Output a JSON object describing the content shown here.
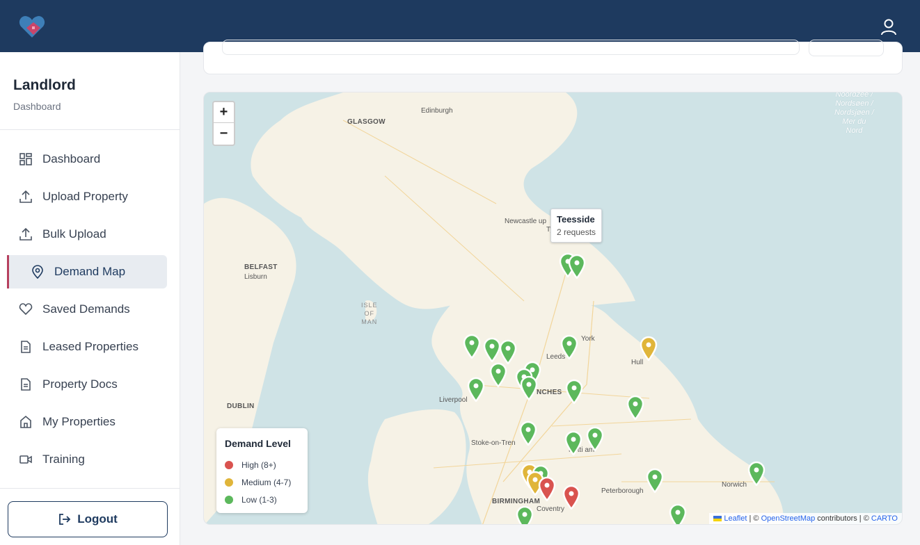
{
  "sidebar": {
    "title": "Landlord",
    "subtitle": "Dashboard",
    "items": [
      {
        "label": "Dashboard",
        "icon": "grid-icon"
      },
      {
        "label": "Upload Property",
        "icon": "upload-icon"
      },
      {
        "label": "Bulk Upload",
        "icon": "upload-icon"
      },
      {
        "label": "Demand Map",
        "icon": "map-pin-icon",
        "active": true
      },
      {
        "label": "Saved Demands",
        "icon": "heart-icon"
      },
      {
        "label": "Leased Properties",
        "icon": "document-icon"
      },
      {
        "label": "Property Docs",
        "icon": "document-icon"
      },
      {
        "label": "My Properties",
        "icon": "home-icon"
      },
      {
        "label": "Training",
        "icon": "video-icon"
      }
    ],
    "logout_label": "Logout"
  },
  "colors": {
    "header": "#1e3a5f",
    "accent": "#b6405e",
    "high": "#d9534f",
    "medium": "#e0b53a",
    "low": "#5cb85c"
  },
  "map": {
    "zoom_in": "+",
    "zoom_out": "−",
    "places": {
      "edinburgh": "Edinburgh",
      "glasgow": "GLASGOW",
      "newcastle": "Newcastle up",
      "newcastle_suffix": "Ty",
      "belfast": "BELFAST",
      "lisburn": "Lisburn",
      "isle_line1": "ISLE",
      "isle_line2": "OF",
      "isle_line3": "MAN",
      "york": "York",
      "leeds": "Leeds",
      "hull": "Hull",
      "manchester": "NCHES",
      "liverpool": "Liverpool",
      "dublin": "DUBLIN",
      "stoke": "Stoke-on-Tren",
      "nottingham": "Notti    am",
      "birmingham": "BIRMINGHAM",
      "coventry": "Coventry",
      "peterborough": "Peterborough",
      "norwich": "Norwich",
      "sea_line1": "Noordzee /",
      "sea_line2": "Nordsøen /",
      "sea_line3": "Nordsjøen /",
      "sea_line4": "Mer du",
      "sea_line5": "Nord"
    },
    "tooltip": {
      "title": "Teesside",
      "subtitle": "2 requests"
    },
    "legend": {
      "title": "Demand Level",
      "items": [
        {
          "label": "High (8+)",
          "color": "#d9534f"
        },
        {
          "label": "Medium (4-7)",
          "color": "#e0b53a"
        },
        {
          "label": "Low (1-3)",
          "color": "#5cb85c"
        }
      ]
    },
    "attribution": {
      "leaflet": "Leaflet",
      "sep1": " | © ",
      "osm": "OpenStreetMap",
      "contributors": " contributors | © ",
      "carto": "CARTO"
    }
  }
}
